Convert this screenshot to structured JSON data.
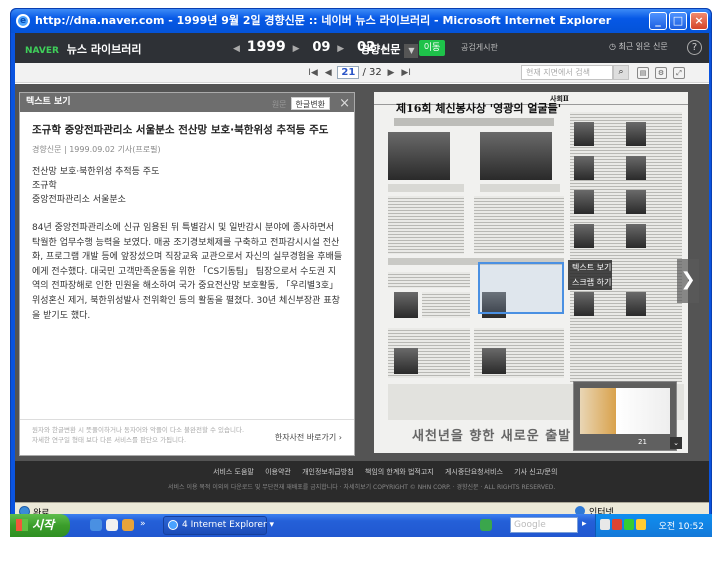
{
  "window": {
    "title": "http://dna.naver.com - 1999년 9월 2일 경향신문 :: 네이버 뉴스 라이브러리 - Microsoft Internet Explorer",
    "minimize": "_",
    "maximize": "□",
    "close": "×"
  },
  "header": {
    "brand_naver": "NAVER",
    "brand_title": "뉴스 라이브러리",
    "prev": "◀",
    "year": "1999",
    "month": "09",
    "day": "02",
    "next": "▶",
    "newspaper": "경향신문",
    "go": "이동",
    "cleanup": "공검게시판",
    "recent": "최근 읽은 신문",
    "help": "?"
  },
  "toolbar": {
    "first": "I◀",
    "prev": "◀",
    "current_page": "21",
    "separator": "/",
    "total_pages": "32",
    "next": "▶",
    "last": "▶I",
    "search_placeholder": "현재 지면에서 검색"
  },
  "text_panel": {
    "heading": "텍스트 보기",
    "tab_original": "원문",
    "tab_hangul": "한글변환",
    "close": "×",
    "article_title": "조규학 중앙전파관리소 서울분소 전산망 보호·북한위성 추적등 주도",
    "article_meta": "경향신문 | 1999.09.02 기사(프로필)",
    "summary": [
      "전산망 보호·북한위성 추적등 주도",
      "조규학",
      "중앙전파관리소 서울분소"
    ],
    "body": "84년 중앙전파관리소에 신규 임용된 뒤 특별감시 및 일반감시 분야에 종사하면서 탁월한 업무수행 능력을 보였다. 매공 조기경보체제를 구축하고 전파감시시설 전산화, 프로그램 개발 등에 앞장섰으며 직장교육 교관으로서 자신의 실무경험을 후배들에게 전수했다. 대국민 고객만족운동을 위한 「CS기동팀」 팀장으로서 수도권 지역의 전파장해로 인한 민원을 해소하여 국가 중요전산망 보호활동, 「우리별3호」 위성혼신 제거, 북한위성발사 전위확인 등의 활동을 펼쳤다. 30년 체신부장관 표창을 받기도 했다.",
    "footer_notes": [
      "원자와 한글변환 시 뜻풀이하거나 동자어와 악플이 다소 불완전할 수 있습니다.",
      "자세한 연구일 형태 보다 다른 서비스를 판단으 가됩니다."
    ],
    "dict_link": "한자사전 바로가기 ›"
  },
  "newspaper": {
    "headline": "제16회 체신봉사상 '영광의 얼굴들'",
    "section": "사회Ⅱ",
    "bottom_text": "새천년을 향한 새로운 출발",
    "context_menu": [
      "텍스트 보기",
      "스크랩 하기"
    ],
    "thumb_page": "21",
    "next_arrow": "❯",
    "thumb_toggle": "⌄"
  },
  "footer": {
    "links": [
      "서비스 도움말",
      "이용약관",
      "개인정보취급방침",
      "책임의 한계와 법적고지",
      "게시중단요청서비스",
      "기사 신고/문의"
    ],
    "note": "서비스 이용 목적 이외의 다운로드 및 무단전재 재배포를 금지합니다 · 자세히보기     COPYRIGHT © NHN CORP. · 경향신문 · ALL RIGHTS RESERVED."
  },
  "status": {
    "text": "완료",
    "zone": "인터넷"
  },
  "taskbar": {
    "start": "시작",
    "task_label": "4 Internet Explorer",
    "search_placeholder": "Google",
    "clock": "오전 10:52"
  }
}
